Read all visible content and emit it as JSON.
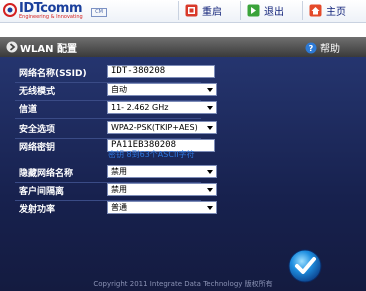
{
  "header": {
    "brand": "IDTcomm",
    "tagline": "Engineering & Innovating",
    "badge": "CM",
    "nav": {
      "home": "重启",
      "logout": "退出",
      "main": "主页"
    }
  },
  "titlebar": {
    "title": "WLAN 配置",
    "help": "帮助"
  },
  "form": {
    "ssid": {
      "label": "网络名称(SSID)",
      "value": "IDT-380208"
    },
    "wireless_mode": {
      "label": "无线模式",
      "value": "自动"
    },
    "channel": {
      "label": "信道",
      "value": "11- 2.462 GHz"
    },
    "security": {
      "label": "安全选项",
      "value": "WPA2-PSK(TKIP+AES)"
    },
    "password": {
      "label": "网络密钥",
      "value": "PA11EB380208",
      "hint": "密钥 8到63个ASCII字符"
    },
    "hide_ssid": {
      "label": "隐藏网络名称",
      "value": "禁用"
    },
    "client_isolation": {
      "label": "客户间隔离",
      "value": "禁用"
    },
    "tx_power": {
      "label": "发射功率",
      "value": "普通"
    }
  },
  "footer": {
    "copyright": "Copyright 2011 Integrate Data Technology 版权所有"
  },
  "colors": {
    "panel_top": "#25356f",
    "panel_bottom": "#141b40",
    "titlebar": "#4a4a4a",
    "hint": "#2f78e0",
    "nav_text": "#12237a"
  }
}
